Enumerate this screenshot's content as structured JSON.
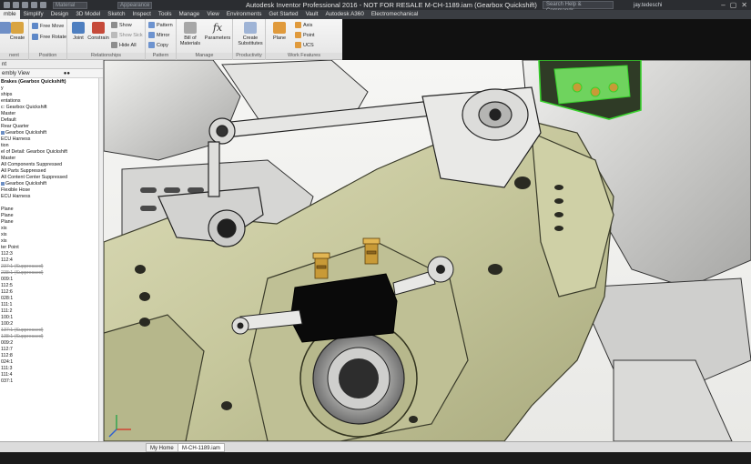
{
  "titlebar": {
    "selector_1": "Material",
    "selector_2": "Appearance",
    "title": "Autodesk Inventor Professional 2016 - NOT FOR RESALE     M-CH-1189.iam (Gearbox Quickshift)",
    "search_placeholder": "Search Help & Commands...",
    "user": "jay.tedeschi",
    "win_min": "–",
    "win_max": "▢",
    "win_close": "✕"
  },
  "tabs": [
    {
      "label": "mble",
      "active": true
    },
    {
      "label": "Simplify"
    },
    {
      "label": "Design"
    },
    {
      "label": "3D Model"
    },
    {
      "label": "Sketch"
    },
    {
      "label": "Inspect"
    },
    {
      "label": "Tools"
    },
    {
      "label": "Manage"
    },
    {
      "label": "View"
    },
    {
      "label": "Environments"
    },
    {
      "label": "Get Started"
    },
    {
      "label": "Vault"
    },
    {
      "label": "Autodesk A360"
    },
    {
      "label": "Electromechanical"
    }
  ],
  "ribbon": {
    "component": {
      "label": "nent",
      "create": "Create"
    },
    "position": {
      "label": "Position",
      "free_move": "Free Move",
      "free_rotate": "Free Rotate"
    },
    "relationships": {
      "label": "Relationships",
      "joint": "Joint",
      "constrain": "Constrain",
      "show": "Show",
      "show_sick": "Show Sick",
      "hide_all": "Hide All"
    },
    "pattern": {
      "label": "Pattern",
      "pattern": "Pattern",
      "mirror": "Mirror",
      "copy": "Copy"
    },
    "manage": {
      "label": "Manage",
      "bom_line1": "Bill of",
      "bom_line2": "Materials",
      "parameters": "Parameters",
      "fx": "fx"
    },
    "productivity": {
      "label": "Productivity",
      "create_line1": "Create",
      "create_line2": "Substitutes"
    },
    "work_features": {
      "label": "Work Features",
      "plane": "Plane",
      "axis": "Axis",
      "point": "Point",
      "ucs": "UCS"
    }
  },
  "browser": {
    "header": "nt",
    "view": "embly View",
    "items": [
      {
        "text": "Brakes (Gearbox Quickshift)",
        "style": "sel"
      },
      {
        "text": "y"
      },
      {
        "text": "ships"
      },
      {
        "text": "entations"
      },
      {
        "text": "c: Gearbox Quickshift"
      },
      {
        "text": "Master"
      },
      {
        "text": "Default"
      },
      {
        "text": "Rear Quarter"
      },
      {
        "text": "Gearbox Quickshift",
        "icon": true
      },
      {
        "text": "ECU Harness"
      },
      {
        "text": "tion"
      },
      {
        "text": "el of Detail: Gearbox Quickshift"
      },
      {
        "text": "Master"
      },
      {
        "text": "All Components Suppressed"
      },
      {
        "text": "All Parts Suppressed"
      },
      {
        "text": "All Content Center Suppressed"
      },
      {
        "text": "Gearbox Quickshift",
        "icon": true
      },
      {
        "text": "Flexible Hose"
      },
      {
        "text": "ECU Harness"
      },
      {
        "text": ""
      },
      {
        "text": "Plane"
      },
      {
        "text": "Plane"
      },
      {
        "text": "Plane"
      },
      {
        "text": "xis"
      },
      {
        "text": "xis"
      },
      {
        "text": "xis"
      },
      {
        "text": "ter Point"
      },
      {
        "text": "112:3"
      },
      {
        "text": "112:4"
      },
      {
        "text": "237:1 (Suppressed)",
        "style": "sup"
      },
      {
        "text": "238:1 (Suppressed)",
        "style": "sup"
      },
      {
        "text": "009:1"
      },
      {
        "text": "112:5"
      },
      {
        "text": "112:6"
      },
      {
        "text": "028:1"
      },
      {
        "text": "111:1"
      },
      {
        "text": "111:2"
      },
      {
        "text": "100:1"
      },
      {
        "text": "100:2"
      },
      {
        "text": "137:1 (Suppressed)",
        "style": "sup"
      },
      {
        "text": "138:1 (Suppressed)",
        "style": "sup"
      },
      {
        "text": "009:2"
      },
      {
        "text": "112:7"
      },
      {
        "text": "112:8"
      },
      {
        "text": "024:1"
      },
      {
        "text": "111:3"
      },
      {
        "text": "111:4"
      },
      {
        "text": "037:1"
      }
    ]
  },
  "doc_tabs": [
    {
      "label": "My Home"
    },
    {
      "label": "M-CH-1189.iam"
    }
  ],
  "colors": {
    "casting": "#c8c9a0",
    "casting_dark": "#8f9166",
    "metal": "#d8d8d6",
    "metal_dark": "#7b7b7b",
    "highlight_green": "#37d12b",
    "brass": "#c89a37",
    "black_part": "#0a0a0a"
  }
}
